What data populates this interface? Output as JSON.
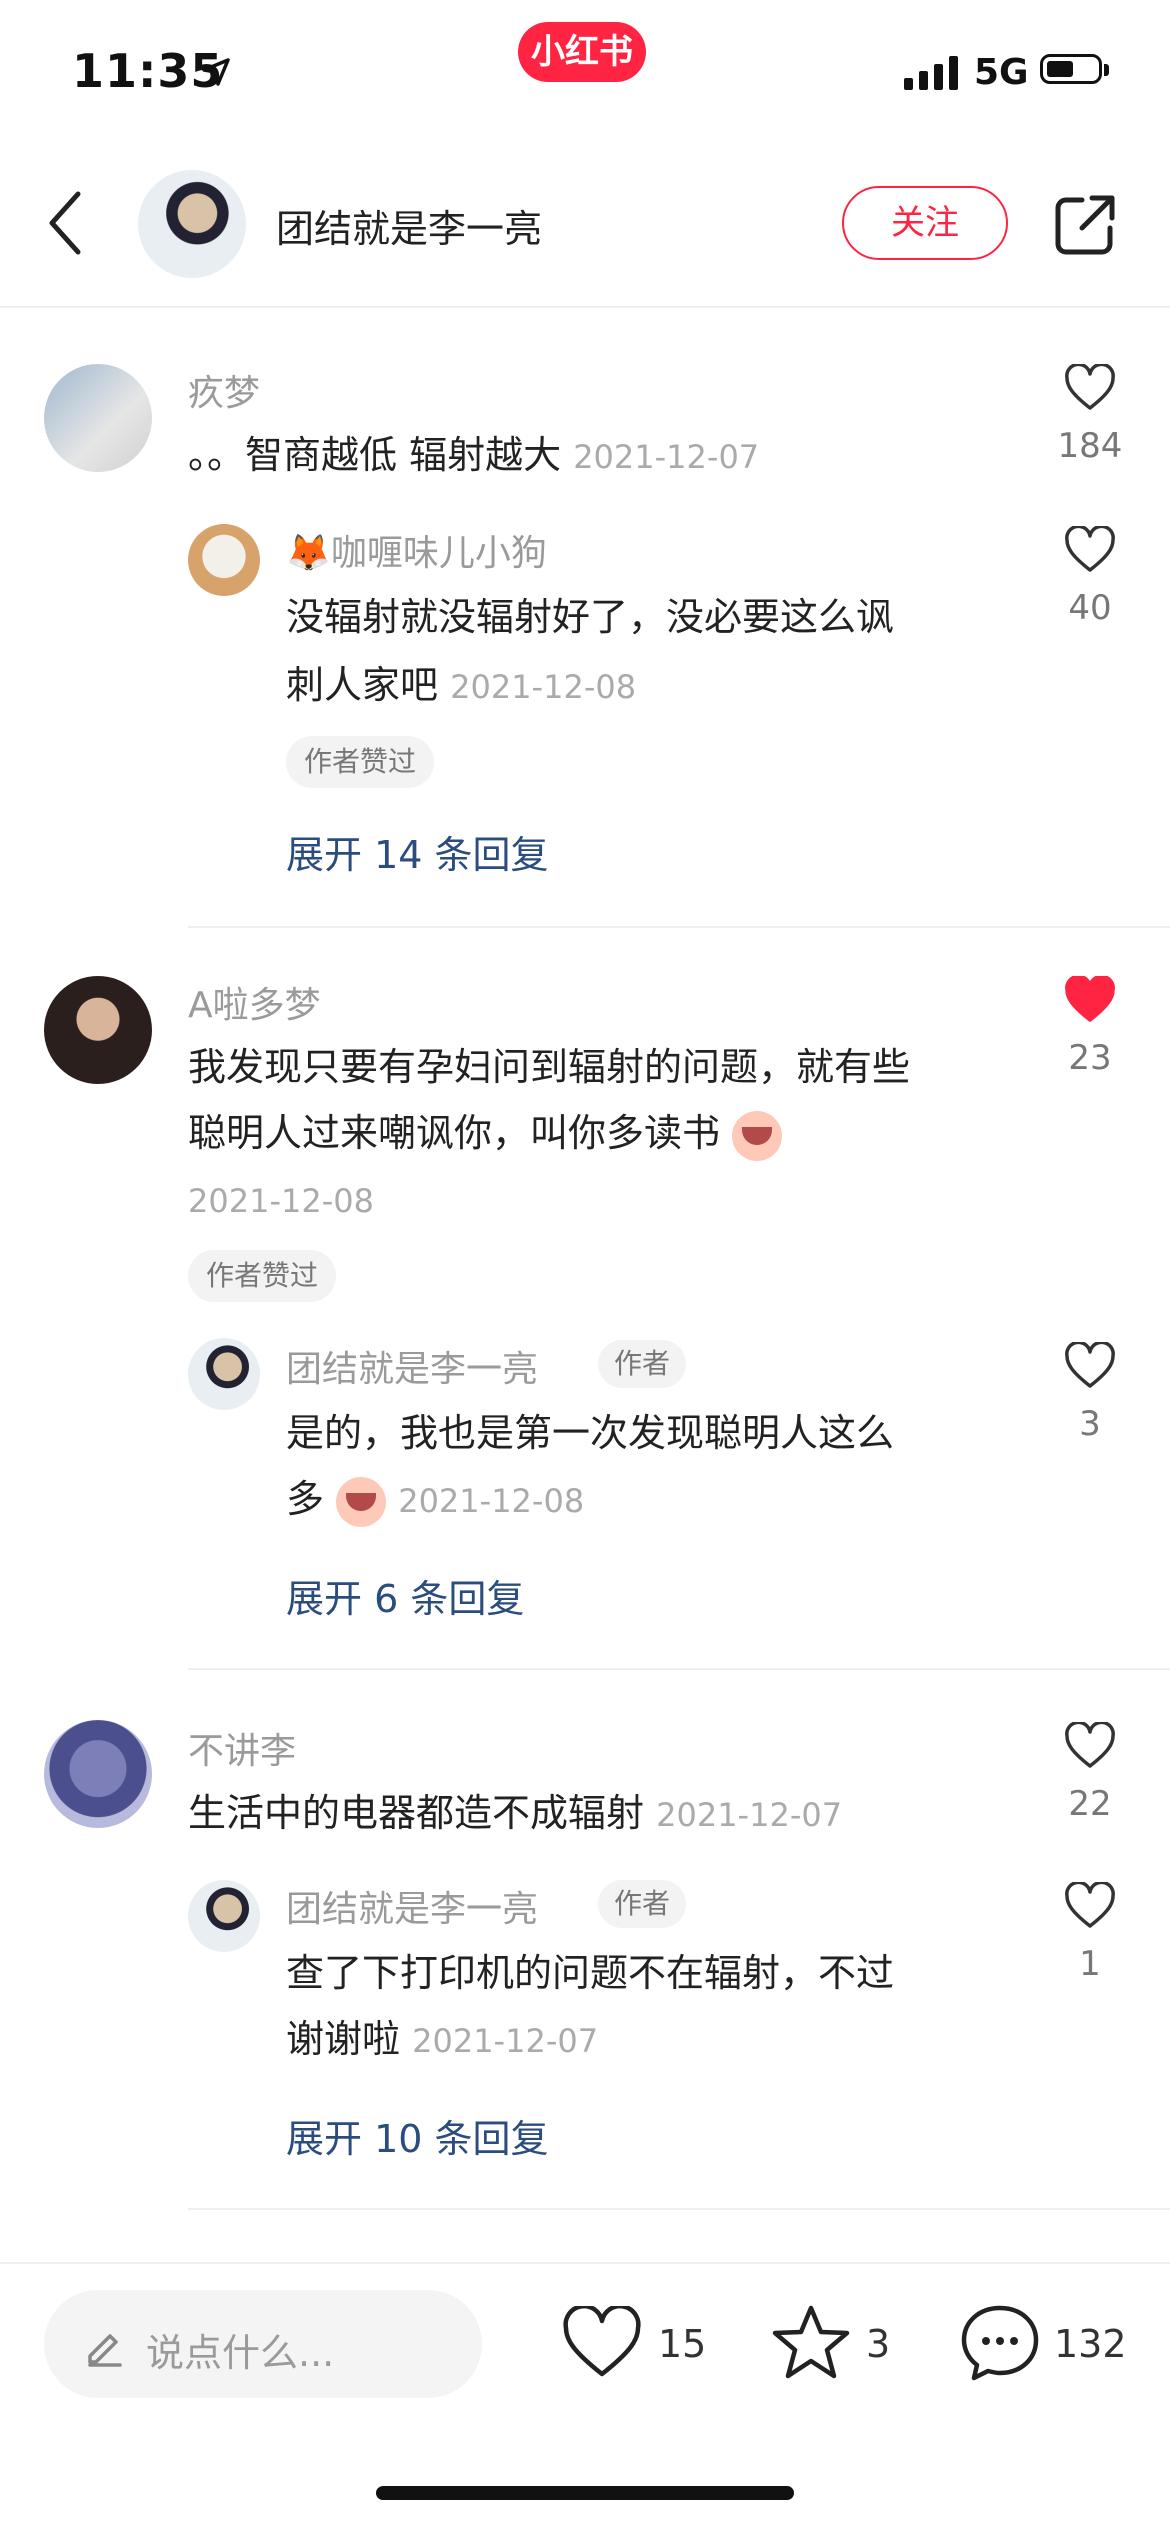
{
  "status_bar": {
    "time": "11:35",
    "brand": "小红书",
    "network": "5G"
  },
  "header": {
    "author": "团结就是李一亮",
    "follow_label": "关注"
  },
  "comments": [
    {
      "user": "疚梦",
      "text": "。。智商越低 辐射越大",
      "date": "2021-12-07",
      "likes": "184",
      "liked": false,
      "reply": {
        "user": "🦊咖喱味儿小狗",
        "line1": "没辐射就没辐射好了，没必要这么讽",
        "line2": "刺人家吧",
        "date": "2021-12-08",
        "likes": "40",
        "tag": "作者赞过"
      },
      "expand": "展开 14 条回复"
    },
    {
      "user": "A啦多梦",
      "line1": "我发现只要有孕妇问到辐射的问题，就有些",
      "line2": "聪明人过来嘲讽你，叫你多读书",
      "date": "2021-12-08",
      "likes": "23",
      "liked": true,
      "tag": "作者赞过",
      "reply": {
        "user": "团结就是李一亮",
        "author_tag": "作者",
        "line1": "是的，我也是第一次发现聪明人这么",
        "line2": "多",
        "date": "2021-12-08",
        "likes": "3"
      },
      "expand": "展开 6 条回复"
    },
    {
      "user": "不讲李",
      "text": "生活中的电器都造不成辐射",
      "date": "2021-12-07",
      "likes": "22",
      "liked": false,
      "reply": {
        "user": "团结就是李一亮",
        "author_tag": "作者",
        "line1": "查了下打印机的问题不在辐射，不过",
        "line2": "谢谢啦",
        "date": "2021-12-07",
        "likes": "1"
      },
      "expand": "展开 10 条回复"
    }
  ],
  "bottom_bar": {
    "input_placeholder": "说点什么...",
    "likes": "15",
    "stars": "3",
    "comments": "132"
  },
  "colors": {
    "brand": "#ff2442",
    "link": "#2b4d7e",
    "muted": "#9a9a9a"
  }
}
